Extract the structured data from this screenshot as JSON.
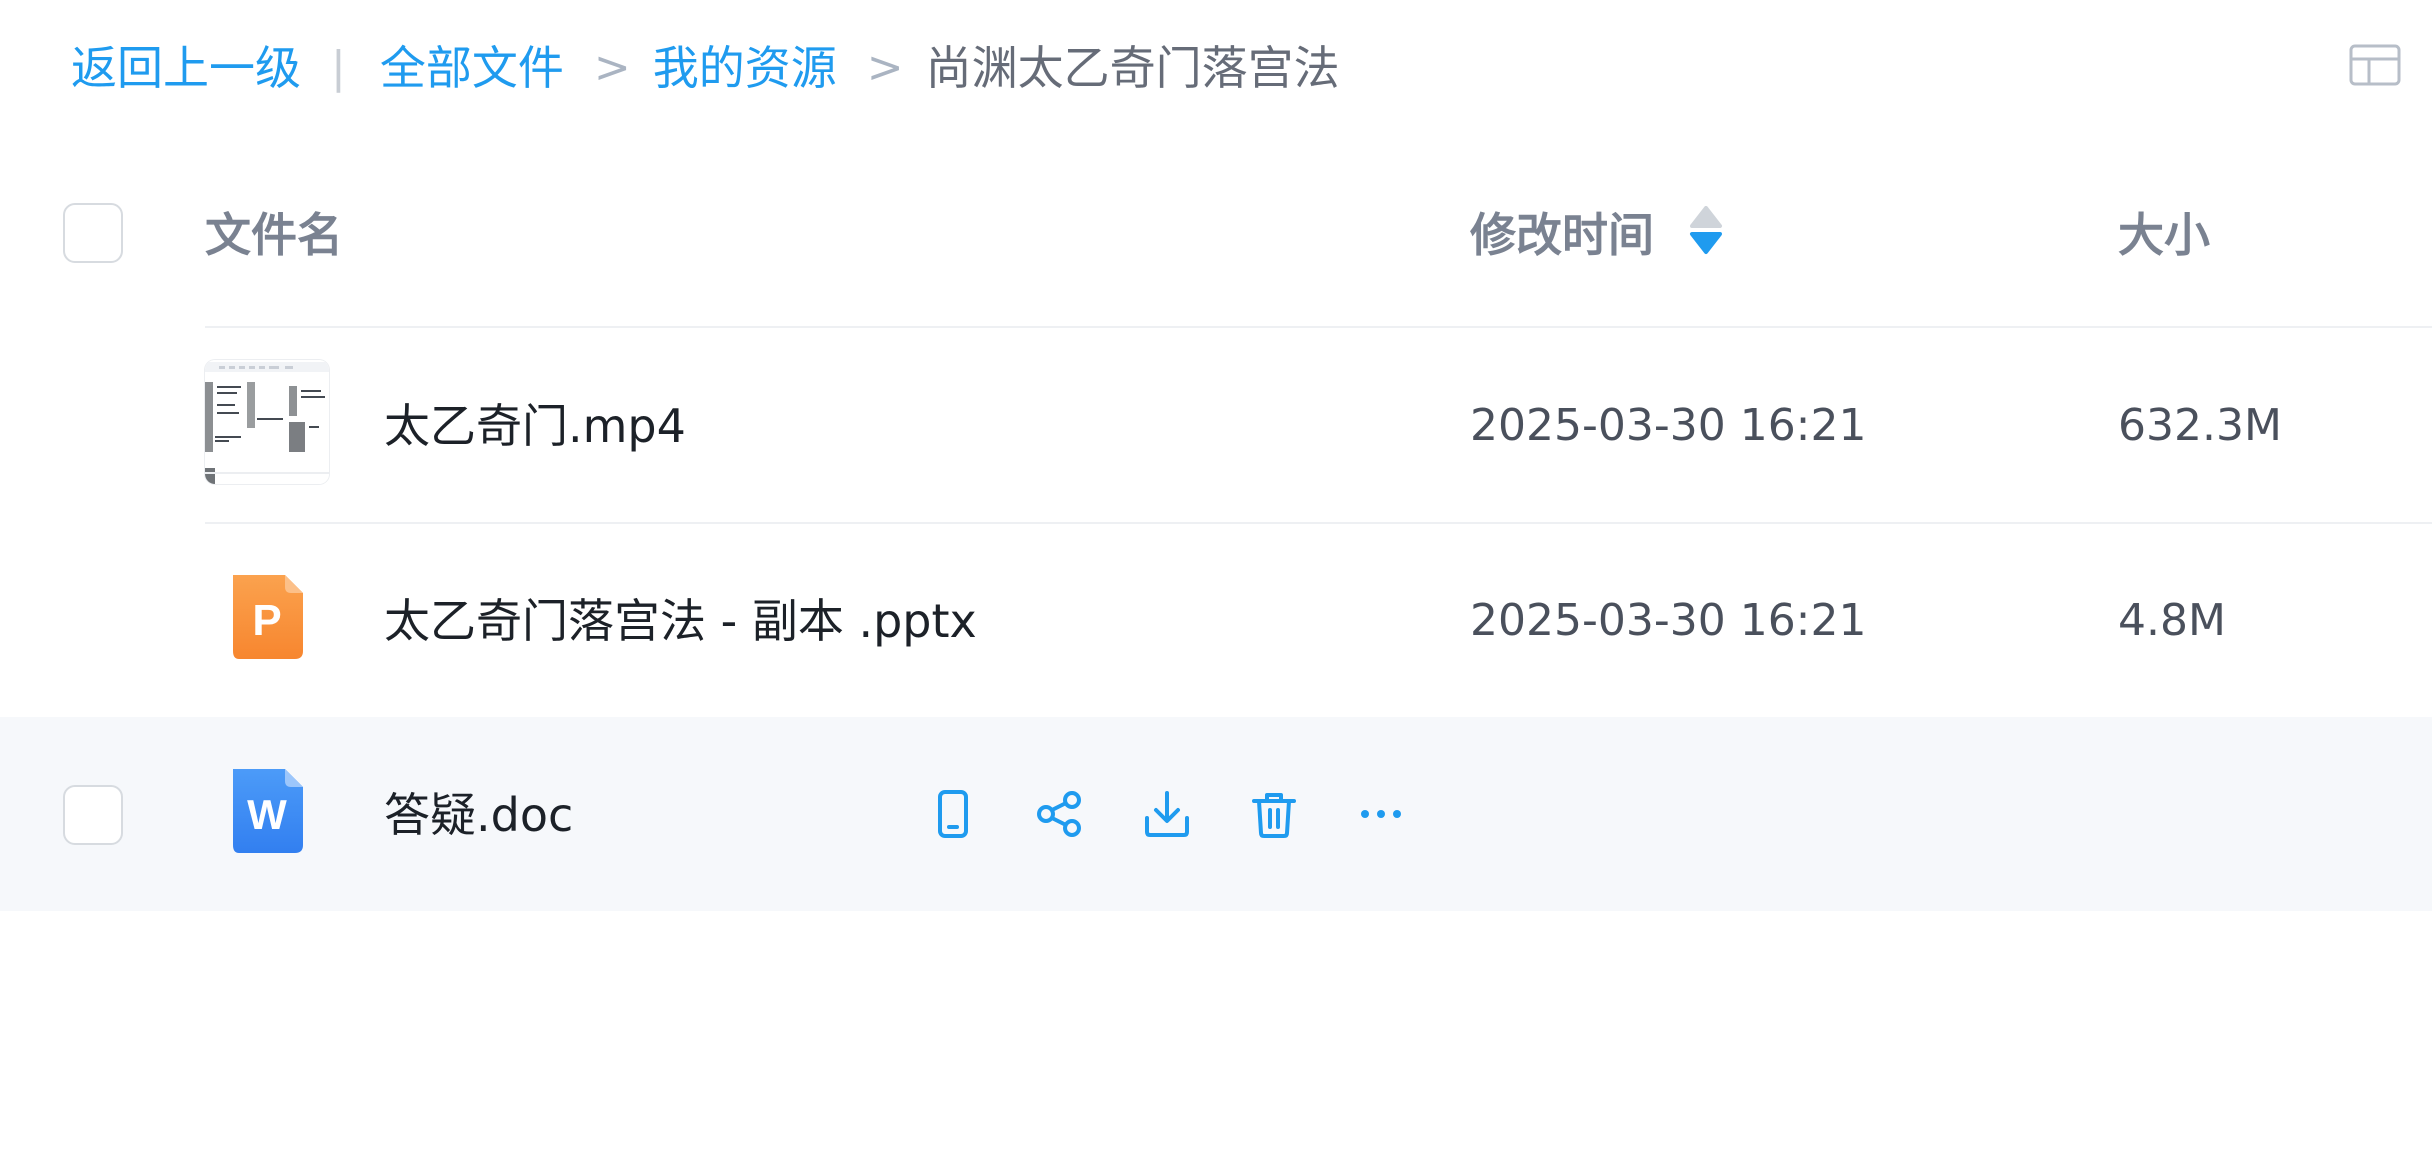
{
  "breadcrumb": {
    "back": "返回上一级",
    "separator_bar": "|",
    "separator": ">",
    "all_files": "全部文件",
    "my_resources": "我的资源",
    "current": "尚渊太乙奇门落宫法"
  },
  "table": {
    "columns": {
      "name": "文件名",
      "modified": "修改时间",
      "size": "大小"
    },
    "sort": {
      "column": "modified",
      "direction": "descending"
    },
    "rows": [
      {
        "name": "太乙奇门.mp4",
        "modified": "2025-03-30 16:21",
        "size": "632.3M",
        "type": "video",
        "icon": "video-thumbnail-icon"
      },
      {
        "name": "太乙奇门落宫法 - 副本 .pptx",
        "modified": "2025-03-30 16:21",
        "size": "4.8M",
        "type": "pptx",
        "icon": "ppt-file-icon",
        "icon_letter": "P"
      },
      {
        "name": "答疑.doc",
        "modified": "",
        "size": "",
        "type": "doc",
        "icon": "word-file-icon",
        "icon_letter": "W",
        "hovered": true
      }
    ],
    "row_actions": [
      "phone-icon",
      "share-icon",
      "download-icon",
      "delete-icon",
      "more-icon"
    ]
  },
  "colors": {
    "accent": "#1f9bef",
    "ppt": "#f98f3c",
    "word": "#3f8cf5",
    "hover_row": "#f6f8fb"
  }
}
